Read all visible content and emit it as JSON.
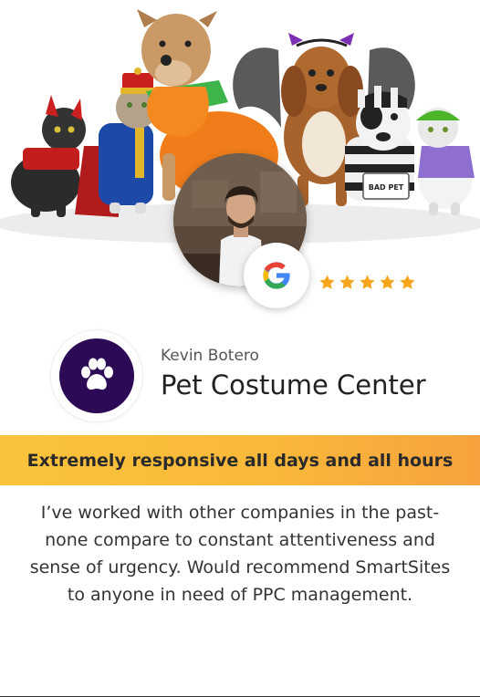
{
  "testimonial": {
    "reviewer_name": "Kevin Botero",
    "business_name": "Pet Costume Center",
    "headline": "Extremely responsive all days and all hours",
    "review_text": "I’ve worked with other companies in the past- none compare to constant attentiveness and sense of urgency. Would recommend SmartSites to anyone in need of PPC management.",
    "rating": 5,
    "rating_max": 5,
    "hero_sign": "BAD PET"
  },
  "colors": {
    "headline_bg": "#fbc33b",
    "star": "#f6a61c",
    "logo_bg": "#2c0a55"
  },
  "icons": {
    "review_source": "google-icon",
    "business_logo": "paw-icon"
  }
}
